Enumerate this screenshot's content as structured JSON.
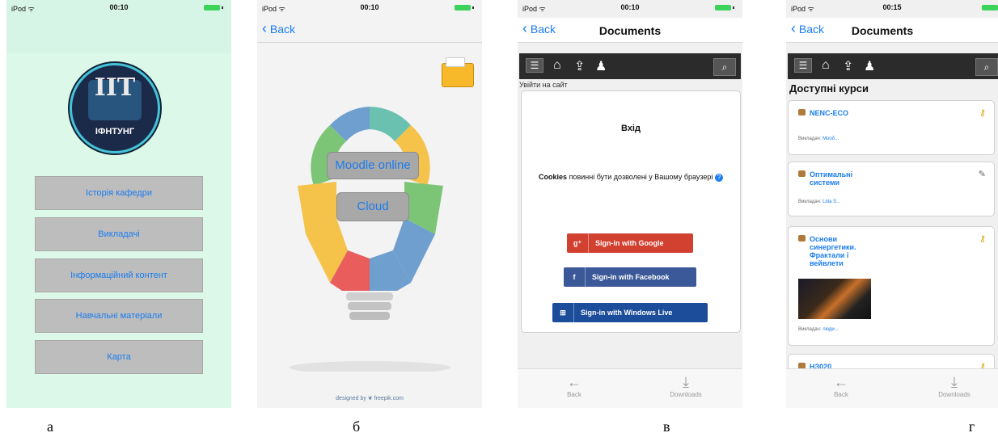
{
  "status": {
    "carrier": "iPod ᯤ",
    "time_a": "00:10",
    "time_b": "00:10",
    "time_c": "00:10",
    "time_d": "00:15"
  },
  "screen_a": {
    "logo_text": "IIT",
    "logo_name": "ІФНТУНГ",
    "menu": [
      "Історія кафедри",
      "Викладачі",
      "Інформаційний контент",
      "Навчальні матеріали",
      "Карта"
    ]
  },
  "screen_b": {
    "back": "Back",
    "btn_moodle": "Moodle online",
    "btn_cloud": "Cloud",
    "footer": "designed by ❦ freepik.com"
  },
  "screen_c": {
    "back": "Back",
    "title": "Documents",
    "site_link": "Увійти на сайт",
    "login_title": "Вхід",
    "cookies_bold": "Cookies",
    "cookies_text": " повинні бути дозволені у Вашому браузері",
    "google": "Sign-in with Google",
    "facebook": "Sign-in with Facebook",
    "windows": "Sign-in with Windows Live",
    "nav_back": "Back",
    "nav_downloads": "Downloads"
  },
  "screen_d": {
    "back": "Back",
    "title": "Documents",
    "heading": "Доступні курси",
    "teacher_label": "Викладач:",
    "courses": [
      {
        "name": "NENC-ECO",
        "teacher": "Mooδ..."
      },
      {
        "name": "Оптимальні системи",
        "teacher": "Lida S..."
      },
      {
        "name": "Основи синергетики. Фрактали і вейвлети",
        "teacher": "люди..."
      },
      {
        "name": "НЗ020"
      }
    ],
    "nav_back": "Back",
    "nav_downloads": "Downloads"
  },
  "captions": [
    "а",
    "б",
    "в",
    "г"
  ],
  "colors": {
    "ios_blue": "#1a7cf0",
    "google": "#d2402f",
    "facebook": "#3b5998",
    "windows": "#1b4d9a",
    "mint": "#d7f5e6"
  }
}
